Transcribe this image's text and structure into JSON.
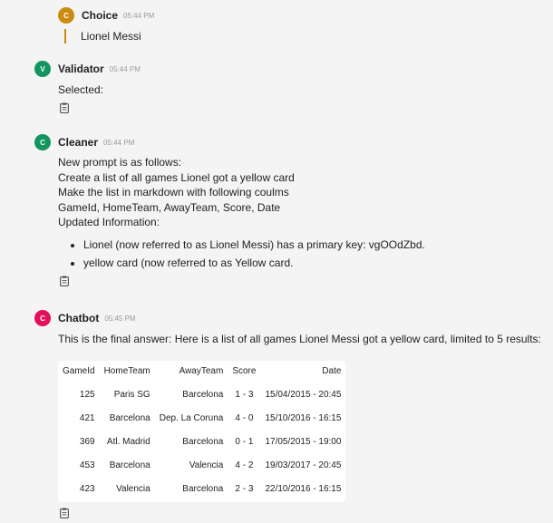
{
  "colors": {
    "choice": "#c98b12",
    "validator": "#12955e",
    "cleaner": "#12955e",
    "chatbot": "#e2105a"
  },
  "choice": {
    "initial": "C",
    "name": "Choice",
    "time": "05:44 PM",
    "text": "Lionel Messi"
  },
  "validator": {
    "initial": "V",
    "name": "Validator",
    "time": "05:44 PM",
    "text": "Selected:",
    "icon": "clipboard-icon"
  },
  "cleaner": {
    "initial": "C",
    "name": "Cleaner",
    "time": "05:44 PM",
    "lines": [
      "New prompt is as follows:",
      "Create a list of all games Lionel got a yellow card",
      "Make the list in markdown with following coulms",
      "GameId, HomeTeam, AwayTeam, Score, Date",
      "Updated Information:"
    ],
    "bullets": [
      "Lionel (now referred to as Lionel Messi) has a primary key: vgOOdZbd.",
      "yellow card (now referred to as Yellow card."
    ],
    "icon": "clipboard-icon"
  },
  "chatbot": {
    "initial": "C",
    "name": "Chatbot",
    "time": "05:45 PM",
    "text": "This is the final answer: Here is a list of all games Lionel Messi got a yellow card, limited to 5 results:",
    "table": {
      "headers": [
        "GameId",
        "HomeTeam",
        "AwayTeam",
        "Score",
        "Date"
      ],
      "rows": [
        [
          "125",
          "Paris SG",
          "Barcelona",
          "1 - 3",
          "15/04/2015 - 20:45"
        ],
        [
          "421",
          "Barcelona",
          "Dep. La Coruna",
          "4 - 0",
          "15/10/2016 - 16:15"
        ],
        [
          "369",
          "Atl. Madrid",
          "Barcelona",
          "0 - 1",
          "17/05/2015 - 19:00"
        ],
        [
          "453",
          "Barcelona",
          "Valencia",
          "4 - 2",
          "19/03/2017 - 20:45"
        ],
        [
          "423",
          "Valencia",
          "Barcelona",
          "2 - 3",
          "22/10/2016 - 16:15"
        ]
      ]
    },
    "icon": "clipboard-icon"
  }
}
